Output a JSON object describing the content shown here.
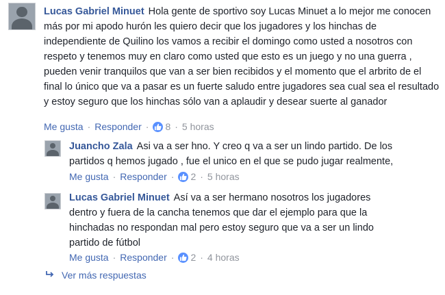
{
  "comments": [
    {
      "author": "Lucas Gabriel Minuet",
      "text": "Hola gente de sportivo soy Lucas Minuet a lo mejor me conocen más por mi apodo hurón les quiero decir que los jugadores y los hinchas de independiente de Quilino los vamos a recibir el domingo como usted a nosotros con respeto y tenemos muy en claro como usted que esto es un juego y no una guerra , pueden venir tranquilos que van a ser bien recibidos y el momento que el arbrito de el final lo único que va a pasar es un fuerte saludo entre jugadores sea cual sea el resultado y estoy seguro que los hinchas sólo van a aplaudir y desear suerte al ganador",
      "like_label": "Me gusta",
      "reply_label": "Responder",
      "likes": "8",
      "time": "5 horas"
    },
    {
      "author": "Juancho Zala",
      "text": "Asi va a ser hno. Y creo q va a ser un lindo partido. De los partidos q hemos jugado , fue el unico en el que se pudo jugar realmente,",
      "like_label": "Me gusta",
      "reply_label": "Responder",
      "likes": "2",
      "time": "5 horas"
    },
    {
      "author": "Lucas Gabriel Minuet",
      "text": "Así va a ser hermano nosotros los jugadores dentro y fuera de la cancha tenemos que dar el ejemplo para que la hinchadas no respondan mal pero estoy seguro que va a ser un lindo partido de fútbol",
      "like_label": "Me gusta",
      "reply_label": "Responder",
      "likes": "2",
      "time": "4 horas"
    }
  ],
  "more_replies": "Ver más respuestas",
  "colors": {
    "link": "#4267b2",
    "author": "#365899",
    "meta": "#90949c",
    "like_badge": "#5890ff"
  },
  "icons": {
    "like": "thumbs-up-icon",
    "more": "reply-arrow-icon"
  }
}
